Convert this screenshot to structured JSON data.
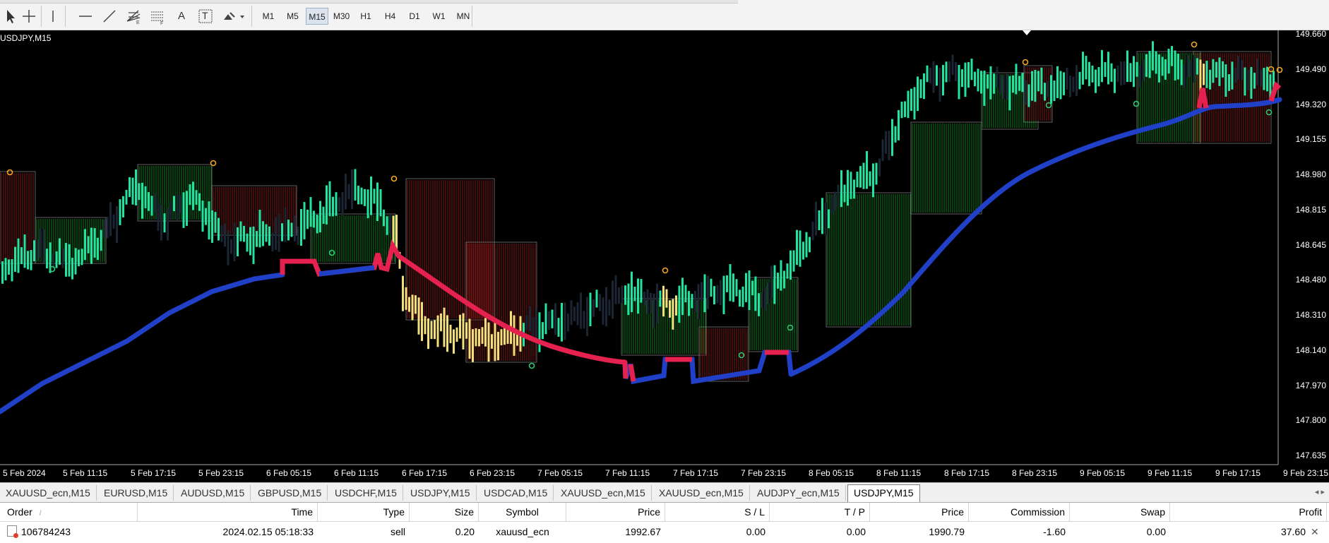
{
  "toolbar": {
    "timeframes": [
      "M1",
      "M5",
      "M15",
      "M30",
      "H1",
      "H4",
      "D1",
      "W1",
      "MN"
    ],
    "active_timeframe": "M15",
    "text_tool_label": "A",
    "text_label_tool": "T"
  },
  "chart": {
    "symbol": "USDJPY,M15",
    "price_axis": [
      "149.660",
      "149.490",
      "149.320",
      "149.155",
      "148.980",
      "148.815",
      "148.645",
      "148.480",
      "148.310",
      "148.140",
      "147.970",
      "147.800",
      "147.635"
    ],
    "time_axis": [
      "5 Feb 2024",
      "5 Feb 11:15",
      "5 Feb 17:15",
      "5 Feb 23:15",
      "6 Feb 05:15",
      "6 Feb 11:15",
      "6 Feb 17:15",
      "6 Feb 23:15",
      "7 Feb 05:15",
      "7 Feb 11:15",
      "7 Feb 17:15",
      "7 Feb 23:15",
      "8 Feb 05:15",
      "8 Feb 11:15",
      "8 Feb 17:15",
      "8 Feb 23:15",
      "9 Feb 05:15",
      "9 Feb 11:15",
      "9 Feb 17:15",
      "9 Feb 23:15"
    ],
    "colors": {
      "background": "#000000",
      "bull_bar": "#22e3a0",
      "bear_bar": "#1c2533",
      "sell_bar": "#f3e07a",
      "ma_up": "#2140c8",
      "ma_down": "#e5214f",
      "cloud_bull": "#0f6b1a",
      "cloud_bear": "#6b1414"
    }
  },
  "tabs": [
    {
      "label": "XAUUSD_ecn,M15",
      "active": false
    },
    {
      "label": "EURUSD,M15",
      "active": false
    },
    {
      "label": "AUDUSD,M15",
      "active": false
    },
    {
      "label": "GBPUSD,M15",
      "active": false
    },
    {
      "label": "USDCHF,M15",
      "active": false
    },
    {
      "label": "USDJPY,M15",
      "active": false
    },
    {
      "label": "USDCAD,M15",
      "active": false
    },
    {
      "label": "XAUUSD_ecn,M15",
      "active": false
    },
    {
      "label": "XAUUSD_ecn,M15",
      "active": false
    },
    {
      "label": "AUDJPY_ecn,M15",
      "active": false
    },
    {
      "label": "USDJPY,M15",
      "active": true
    }
  ],
  "tab_arrows": "◂ ▸",
  "orders": {
    "columns": [
      "Order",
      "Time",
      "Type",
      "Size",
      "Symbol",
      "Price",
      "S / L",
      "T / P",
      "Price",
      "Commission",
      "Swap",
      "Profit"
    ],
    "sort_indicator": "/",
    "rows": [
      {
        "order": "106784243",
        "time": "2024.02.15 05:18:33",
        "type": "sell",
        "size": "0.20",
        "symbol": "xauusd_ecn",
        "price": "1992.67",
        "sl": "0.00",
        "tp": "0.00",
        "price2": "1990.79",
        "commission": "-1.60",
        "swap": "0.00",
        "profit": "37.60"
      }
    ]
  }
}
